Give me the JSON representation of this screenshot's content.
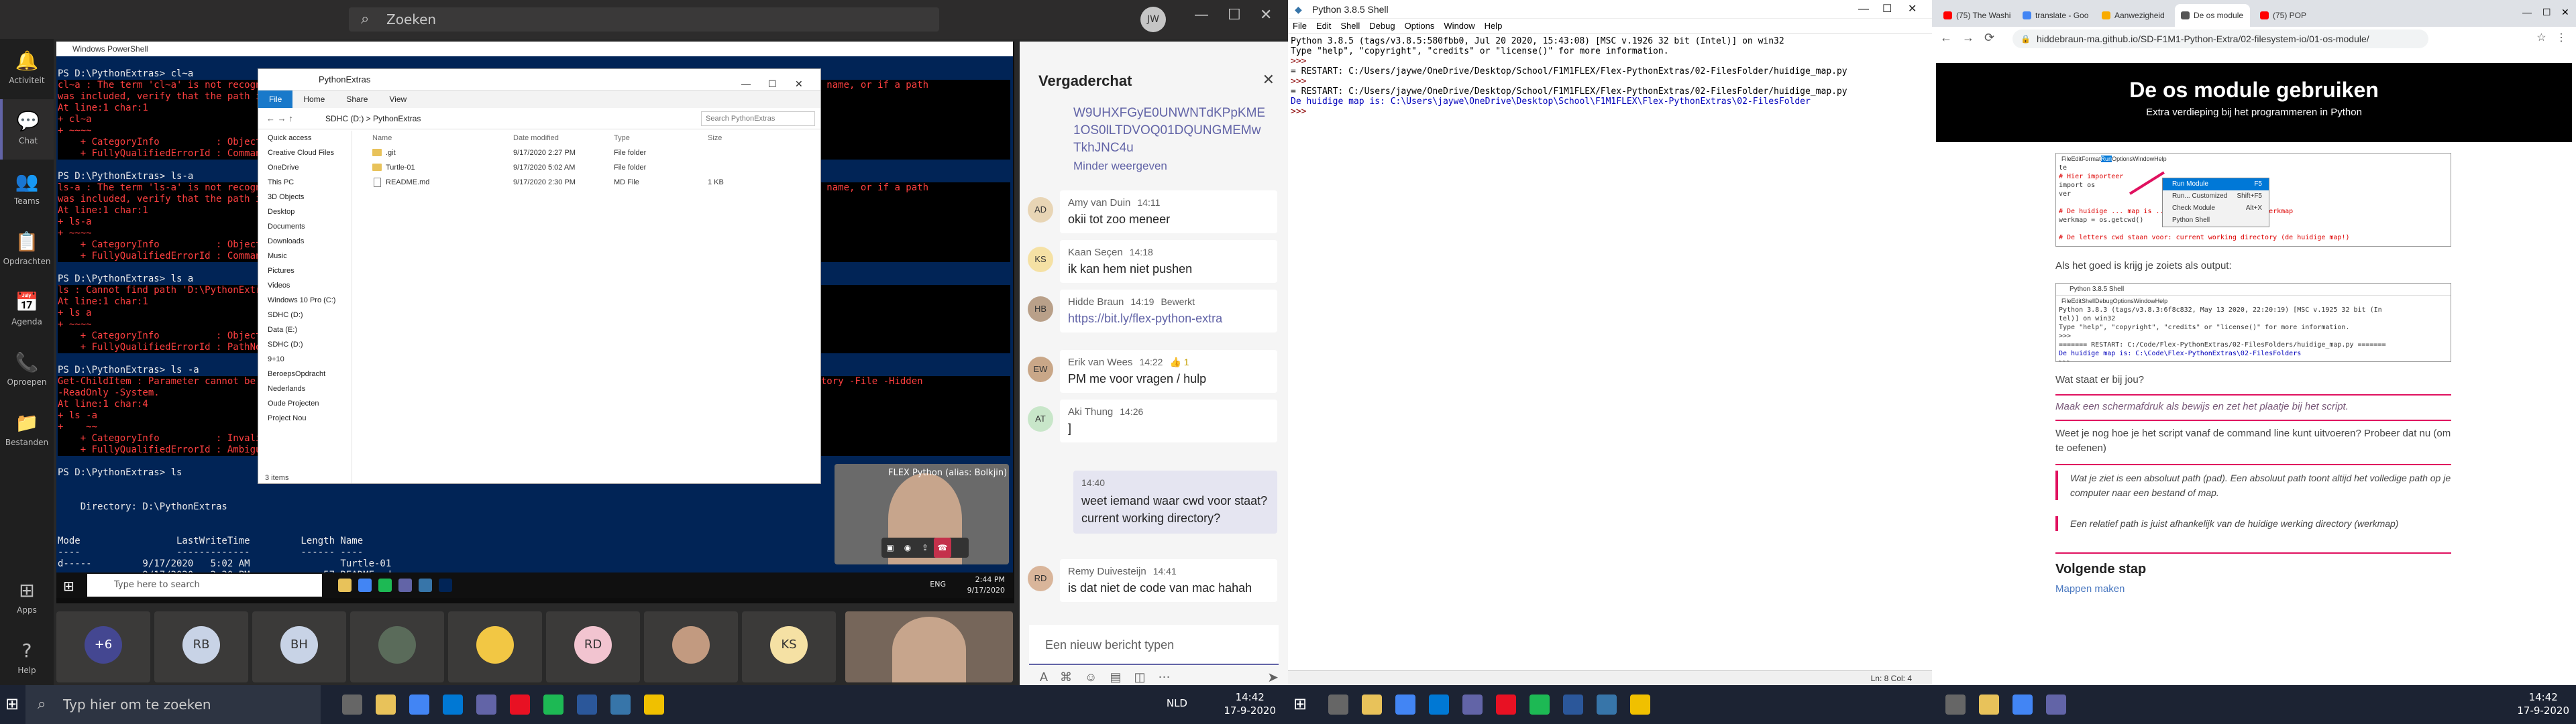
{
  "teams": {
    "search_placeholder": "Zoeken",
    "avatar_initials": "JW",
    "rail": [
      {
        "label": "Activiteit",
        "icon": "bell-icon"
      },
      {
        "label": "Chat",
        "icon": "chat-icon"
      },
      {
        "label": "Teams",
        "icon": "teams-icon"
      },
      {
        "label": "Opdrachten",
        "icon": "assignments-icon"
      },
      {
        "label": "Agenda",
        "icon": "calendar-icon"
      },
      {
        "label": "Oproepen",
        "icon": "phone-icon"
      },
      {
        "label": "Bestanden",
        "icon": "files-icon"
      },
      {
        "label": "Apps",
        "icon": "apps-icon"
      },
      {
        "label": "Help",
        "icon": "help-icon"
      }
    ],
    "chat_title": "Vergaderchat",
    "link_fragment": "W9UHXFGyE0UNWNTdKPpKME1OS0lLTDVOQ01DQUNGMEMwTkhJNC4u",
    "show_less": "Minder weergeven",
    "messages": [
      {
        "initials": "AD",
        "name": "Amy van Duin",
        "time": "14:11",
        "text": "okii tot zoo meneer",
        "avatar_color": "#e8d5b5",
        "is_link": false,
        "edited": ""
      },
      {
        "initials": "KS",
        "name": "Kaan Seçen",
        "time": "14:18",
        "text": "ik kan hem niet pushen",
        "avatar_color": "#f5e1a4",
        "is_link": false,
        "edited": ""
      },
      {
        "initials": "HB",
        "name": "Hidde Braun",
        "time": "14:19",
        "text": "https://bit.ly/flex-python-extra",
        "avatar_color": "#b9a089",
        "is_link": true,
        "edited": "Bewerkt"
      },
      {
        "initials": "EW",
        "name": "Erik van Wees",
        "time": "14:22",
        "text": "PM me voor vragen / hulp",
        "avatar_color": "#c9a788",
        "is_link": false,
        "edited": ""
      },
      {
        "initials": "AT",
        "name": "Aki Thung",
        "time": "14:26",
        "text": "]",
        "avatar_color": "#c8e6c9",
        "is_link": false,
        "edited": ""
      }
    ],
    "reaction": "👍 1",
    "own_message": {
      "time": "14:40",
      "text": "weet iemand waar cwd voor staat? current working directory?"
    },
    "last_message": {
      "initials": "RD",
      "name": "Remy Duivesteijn",
      "time": "14:41",
      "text": "is dat niet de code van mac hahah",
      "avatar_color": "#d9b59a"
    },
    "compose_placeholder": "Een nieuw bericht typen",
    "participants": [
      {
        "label": "+6",
        "color": "#444791"
      },
      {
        "label": "RB",
        "color": "#c8d3e6"
      },
      {
        "label": "BH",
        "color": "#c8d3e6"
      },
      {
        "label": "",
        "color": "#5a6b5a"
      },
      {
        "label": "",
        "color": "#f2c744"
      },
      {
        "label": "RD",
        "color": "#f2c4d0"
      },
      {
        "label": "",
        "color": "#c29a80"
      },
      {
        "label": "KS",
        "color": "#f5e1a4"
      }
    ],
    "video_label": "FLEX Python (alias: Bolkjin)"
  },
  "powershell": {
    "title": "Windows PowerShell",
    "lines": [
      {
        "t": "PS D:\\PythonExtras> cl~a",
        "e": false
      },
      {
        "t": "cl~a : The term 'cl~a' is not recognized as the name of a cmdlet, function, script file, or operable program. Check the spelling of the name, or if a path",
        "e": true
      },
      {
        "t": "was included, verify that the path is correct and try again.",
        "e": true
      },
      {
        "t": "At line:1 char:1",
        "e": true
      },
      {
        "t": "+ cl~a",
        "e": true
      },
      {
        "t": "+ ~~~~",
        "e": true
      },
      {
        "t": "    + CategoryInfo          : ObjectNotFound: (cl~a:String) [], CommandNotFoundException",
        "e": true
      },
      {
        "t": "    + FullyQualifiedErrorId : CommandNotFoundException",
        "e": true
      },
      {
        "t": "",
        "e": false
      },
      {
        "t": "PS D:\\PythonExtras> ls-a",
        "e": false
      },
      {
        "t": "ls-a : The term 'ls-a' is not recognized as the name of a cmdlet, function, script file, or operable program. Check the spelling of the name, or if a path",
        "e": true
      },
      {
        "t": "was included, verify that the path is correct and try again.",
        "e": true
      },
      {
        "t": "At line:1 char:1",
        "e": true
      },
      {
        "t": "+ ls-a",
        "e": true
      },
      {
        "t": "+ ~~~~",
        "e": true
      },
      {
        "t": "    + CategoryInfo          : ObjectNotFound: (ls-a:String) [], CommandNotFoundException",
        "e": true
      },
      {
        "t": "    + FullyQualifiedErrorId : CommandNotFoundException",
        "e": true
      },
      {
        "t": "",
        "e": false
      },
      {
        "t": "PS D:\\PythonExtras> ls a",
        "e": false
      },
      {
        "t": "ls : Cannot find path 'D:\\PythonExtras\\a' because it does not exist.",
        "e": true
      },
      {
        "t": "At line:1 char:1",
        "e": true
      },
      {
        "t": "+ ls a",
        "e": true
      },
      {
        "t": "+ ~~~~",
        "e": true
      },
      {
        "t": "    + CategoryInfo          : ObjectNotFound: (D:\\PythonExtras\\a:String) [Get-ChildItem], ItemNotFoundException",
        "e": true
      },
      {
        "t": "    + FullyQualifiedErrorId : PathNotFound,Microsoft.PowerShell.Commands.GetChildItemCommand",
        "e": true
      },
      {
        "t": "",
        "e": false
      },
      {
        "t": "PS D:\\PythonExtras> ls -a",
        "e": false
      },
      {
        "t": "Get-ChildItem : Parameter cannot be processed because the parameter name 'a' is ambiguous. Possible matches include: -Attributes -Directory -File -Hidden",
        "e": true
      },
      {
        "t": "-ReadOnly -System.",
        "e": true
      },
      {
        "t": "At line:1 char:4",
        "e": true
      },
      {
        "t": "+ ls -a",
        "e": true
      },
      {
        "t": "+    ~~",
        "e": true
      },
      {
        "t": "    + CategoryInfo          : InvalidArgument: (:) [Get-ChildItem], ParameterBindingException",
        "e": true
      },
      {
        "t": "    + FullyQualifiedErrorId : AmbiguousParameter,Microsoft.PowerShell.Commands.GetChildItemCommand",
        "e": true
      },
      {
        "t": "",
        "e": false
      },
      {
        "t": "PS D:\\PythonExtras> ls",
        "e": false
      },
      {
        "t": "",
        "e": false
      },
      {
        "t": "",
        "e": false
      },
      {
        "t": "    Directory: D:\\PythonExtras",
        "e": false
      },
      {
        "t": "",
        "e": false
      },
      {
        "t": "",
        "e": false
      },
      {
        "t": "Mode                 LastWriteTime         Length Name",
        "e": false
      },
      {
        "t": "----                 -------------         ------ ----",
        "e": false
      },
      {
        "t": "d-----         9/17/2020   5:02 AM                Turtle-01",
        "e": false
      },
      {
        "t": "-a----         9/17/2020   2:30 PM             57 README.md",
        "e": false
      }
    ]
  },
  "explorer": {
    "title": "PythonExtras",
    "tabs": [
      "File",
      "Home",
      "Share",
      "View"
    ],
    "path": "SDHC (D:) > PythonExtras",
    "search_placeholder": "Search PythonExtras",
    "nav": [
      "Quick access",
      "Creative Cloud Files",
      "OneDrive",
      "This PC",
      "3D Objects",
      "Desktop",
      "Documents",
      "Downloads",
      "Music",
      "Pictures",
      "Videos",
      "Windows 10 Pro (C:)",
      "SDHC (D:)",
      "Data (E:)",
      "SDHC (D:)",
      "9+10",
      "BeroepsOpdracht",
      "Nederlands",
      "Oude Projecten",
      "Project Nou"
    ],
    "headers": [
      "Name",
      "Date modified",
      "Type",
      "Size"
    ],
    "rows": [
      {
        "name": ".git",
        "date": "9/17/2020 2:27 PM",
        "type": "File folder",
        "size": "",
        "folder": true
      },
      {
        "name": "Turtle-01",
        "date": "9/17/2020 5:02 AM",
        "type": "File folder",
        "size": "",
        "folder": true
      },
      {
        "name": "README.md",
        "date": "9/17/2020 2:30 PM",
        "type": "MD File",
        "size": "1 KB",
        "folder": false
      }
    ],
    "status": "3 items"
  },
  "inner_taskbar": {
    "search": "Type here to search",
    "lang": "ENG",
    "time": "2:44 PM",
    "date": "9/17/2020"
  },
  "taskbar": {
    "search": "Typ hier om te zoeken",
    "lang": "NLD",
    "time": "14:42",
    "date": "17-9-2020"
  },
  "idle": {
    "title": "Python 3.8.5 Shell",
    "menu": [
      "File",
      "Edit",
      "Shell",
      "Debug",
      "Options",
      "Window",
      "Help"
    ],
    "lines": [
      {
        "t": "Python 3.8.5 (tags/v3.8.5:580fbb0, Jul 20 2020, 15:43:08) [MSC v.1926 32 bit (Intel)] on win32",
        "c": ""
      },
      {
        "t": "Type \"help\", \"copyright\", \"credits\" or \"license()\" for more information.",
        "c": ""
      },
      {
        "t": ">>> ",
        "c": "ib-prompt"
      },
      {
        "t": "= RESTART: C:/Users/jaywe/OneDrive/Desktop/School/F1M1FLEX/Flex-PythonExtras/02-FilesFolder/huidige_map.py",
        "c": ""
      },
      {
        "t": ">>> ",
        "c": "ib-prompt"
      },
      {
        "t": "= RESTART: C:/Users/jaywe/OneDrive/Desktop/School/F1M1FLEX/Flex-PythonExtras/02-FilesFolder/huidige_map.py",
        "c": ""
      },
      {
        "t": "De huidige map is: C:\\Users\\jaywe\\OneDrive\\Desktop\\School\\F1M1FLEX\\Flex-PythonExtras\\02-FilesFolder",
        "c": "ib-out"
      },
      {
        "t": ">>> ",
        "c": "ib-prompt"
      }
    ],
    "status": "Ln: 8  Col: 4"
  },
  "chrome": {
    "tabs": [
      {
        "title": "(75) The Washi",
        "color": "#ff0000"
      },
      {
        "title": "translate - Goo",
        "color": "#4285f4"
      },
      {
        "title": "Aanwezigheid",
        "color": "#f9ab00"
      },
      {
        "title": "De os module",
        "color": "#555555"
      },
      {
        "title": "(75) POP",
        "color": "#ff0000"
      }
    ],
    "url": "hiddebraun-ma.github.io/SD-F1M1-Python-Extra/02-filesystem-io/01-os-module/",
    "hero_title": "De os module gebruiken",
    "hero_subtitle": "Extra verdieping bij het programmeren in Python",
    "shot1": {
      "menu": [
        "File",
        "Edit",
        "Format",
        "Run",
        "Options",
        "Window",
        "Help"
      ],
      "lines": [
        "te",
        "# Hier importeer",
        "import os",
        "ver",
        "",
        "# De huidige ... map is ... staan in de variabele: werkmap",
        "werkmap = os.getcwd()",
        "",
        "# De letters cwd staan voor: current working directory (de huidige map!)"
      ],
      "menu_items": [
        {
          "label": "Run Module",
          "shortcut": "F5"
        },
        {
          "label": "Run... Customized",
          "shortcut": "Shift+F5"
        },
        {
          "label": "Check Module",
          "shortcut": "Alt+X"
        },
        {
          "label": "Python Shell",
          "shortcut": ""
        }
      ]
    },
    "p_output": "Als het goed is krijg je zoiets als output:",
    "shot2": {
      "title": "Python 3.8.5 Shell",
      "menu": [
        "File",
        "Edit",
        "Shell",
        "Debug",
        "Options",
        "Window",
        "Help"
      ],
      "lines": [
        "Python 3.8.3 (tags/v3.8.3:6f8c832, May 13 2020, 22:20:19) [MSC v.1925 32 bit (In",
        "tel)] on win32",
        "Type \"help\", \"copyright\", \"credits\" or \"license()\" for more information.",
        ">>>",
        "======= RESTART: C:/Code/Flex-PythonExtras/02-FilesFolders/huidige_map.py =======",
        "De huidige map is: C:\\Code\\Flex-PythonExtras\\02-FilesFolders",
        ">>>"
      ]
    },
    "q_title": "Wat staat er bij jou?",
    "q_italic": "Maak een schermafdruk als bewijs en zet het plaatje bij het script.",
    "q_cmd": "Weet je nog hoe je het script vanaf de command line kunt uitvoeren? Probeer dat nu (om te oefenen)",
    "quote1": "Wat je ziet is een absoluut path (pad). Een absoluut path toont altijd het volledige path op je computer naar een bestand of map.",
    "quote2": "Een relatief path is juist afhankelijk van de huidige werking directory (werkmap)",
    "next_title": "Volgende stap",
    "next_link": "Mappen maken"
  }
}
